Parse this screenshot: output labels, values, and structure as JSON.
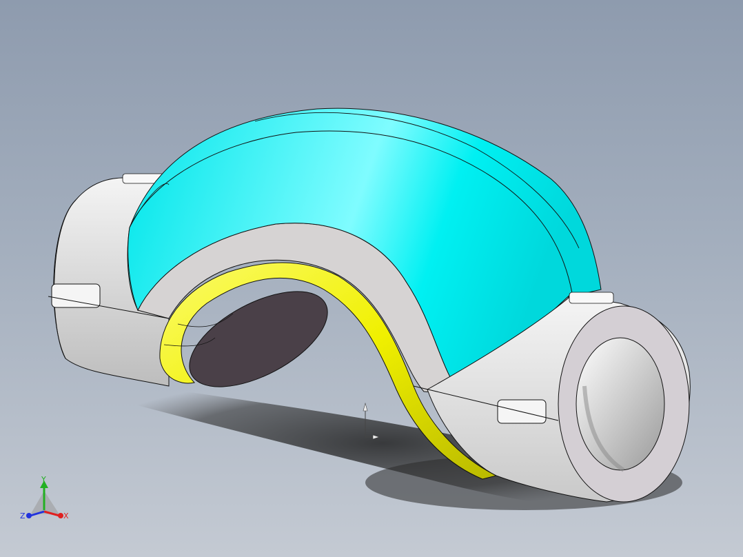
{
  "viewport": {
    "background_top": "#8e9bae",
    "background_bottom": "#c4cad3"
  },
  "model": {
    "name": "pipe-bend-insulation-cutaway",
    "colors": {
      "insulation_outer": "#00f0f0",
      "insulation_section": "#d5d2d2",
      "sleeve": "#efefef",
      "sleeve_end_face": "#d4cfd4",
      "inner_pipe": "#f2f200",
      "pipe_bore": "#4a4048",
      "edge": "#111111"
    }
  },
  "triad": {
    "x_label": "X",
    "y_label": "Y",
    "z_label": "Z",
    "x_color": "#e02020",
    "y_color": "#22b022",
    "z_color": "#2233dd"
  },
  "origin_marker": {
    "icon": "origin-arrows-icon"
  }
}
